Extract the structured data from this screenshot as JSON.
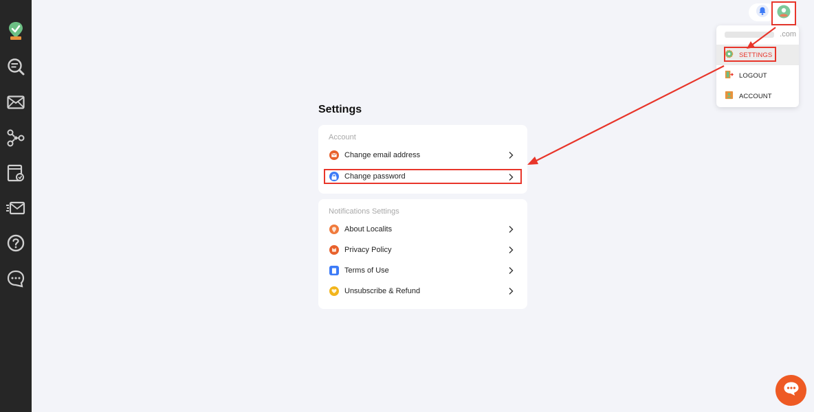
{
  "sidebar": {
    "items": [
      {
        "icon": "app-logo-icon"
      },
      {
        "icon": "search-list-icon"
      },
      {
        "icon": "mail-icon"
      },
      {
        "icon": "network-icon"
      },
      {
        "icon": "browser-window-icon"
      },
      {
        "icon": "send-mail-icon"
      },
      {
        "icon": "help-icon"
      },
      {
        "icon": "chat-bubble-icon"
      }
    ]
  },
  "topbar": {
    "notification_icon": "bell-icon",
    "avatar_icon": "user-avatar-icon"
  },
  "user_menu": {
    "email_visible_suffix": ".com",
    "items": [
      {
        "label": "SETTINGS",
        "icon": "gear-icon",
        "active": true
      },
      {
        "label": "LOGOUT",
        "icon": "logout-door-icon",
        "active": false
      },
      {
        "label": "ACCOUNT",
        "icon": "account-badge-icon",
        "active": false
      }
    ]
  },
  "page": {
    "title": "Settings"
  },
  "account_section": {
    "heading": "Account",
    "items": [
      {
        "label": "Change email address",
        "icon": "envelope-icon",
        "color": "#e8612c"
      },
      {
        "label": "Change password",
        "icon": "lock-icon",
        "color": "#3d7bf7"
      }
    ]
  },
  "notifications_section": {
    "heading": "Notifications Settings",
    "items": [
      {
        "label": "About Localits",
        "icon": "location-pin-icon",
        "color": "#f07a3c"
      },
      {
        "label": "Privacy Policy",
        "icon": "privacy-icon",
        "color": "#e8612c"
      },
      {
        "label": "Terms of Use",
        "icon": "document-icon",
        "color": "#3d7bf7"
      },
      {
        "label": "Unsubscribe & Refund",
        "icon": "heart-icon",
        "color": "#f2b51c"
      }
    ]
  },
  "colors": {
    "sidebar": "#262626",
    "background": "#f3f4f9",
    "highlight": "#e8352a",
    "accent_orange": "#ee5a24"
  },
  "chat_fab": {
    "icon": "chat-icon"
  }
}
